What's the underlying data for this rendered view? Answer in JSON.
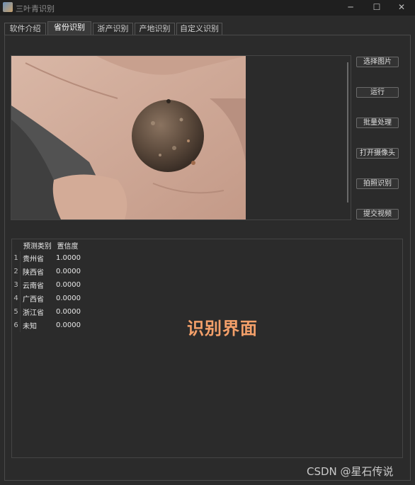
{
  "window": {
    "title": "三叶青识别",
    "minimize": "─",
    "maximize": "☐",
    "close": "✕"
  },
  "tabs": [
    {
      "label": "软件介绍",
      "active": false
    },
    {
      "label": "省份识别",
      "active": true
    },
    {
      "label": "浙产识别",
      "active": false
    },
    {
      "label": "产地识别",
      "active": false
    },
    {
      "label": "自定义识别",
      "active": false
    }
  ],
  "buttons": {
    "select_image": "选择图片",
    "run": "运行",
    "batch": "批量处理",
    "open_camera": "打开摄像头",
    "capture_recognize": "拍照识别",
    "submit_video": "提交视频"
  },
  "table": {
    "headers": [
      "预测类别",
      "置信度"
    ],
    "rows": [
      {
        "num": "1",
        "cls": "贵州省",
        "conf": "1.0000"
      },
      {
        "num": "2",
        "cls": "陕西省",
        "conf": "0.0000"
      },
      {
        "num": "3",
        "cls": "云南省",
        "conf": "0.0000"
      },
      {
        "num": "4",
        "cls": "广西省",
        "conf": "0.0000"
      },
      {
        "num": "5",
        "cls": "浙江省",
        "conf": "0.0000"
      },
      {
        "num": "6",
        "cls": "未知",
        "conf": "0.0000"
      }
    ]
  },
  "overlay_caption": "识别界面",
  "watermark": "CSDN @星石传说"
}
